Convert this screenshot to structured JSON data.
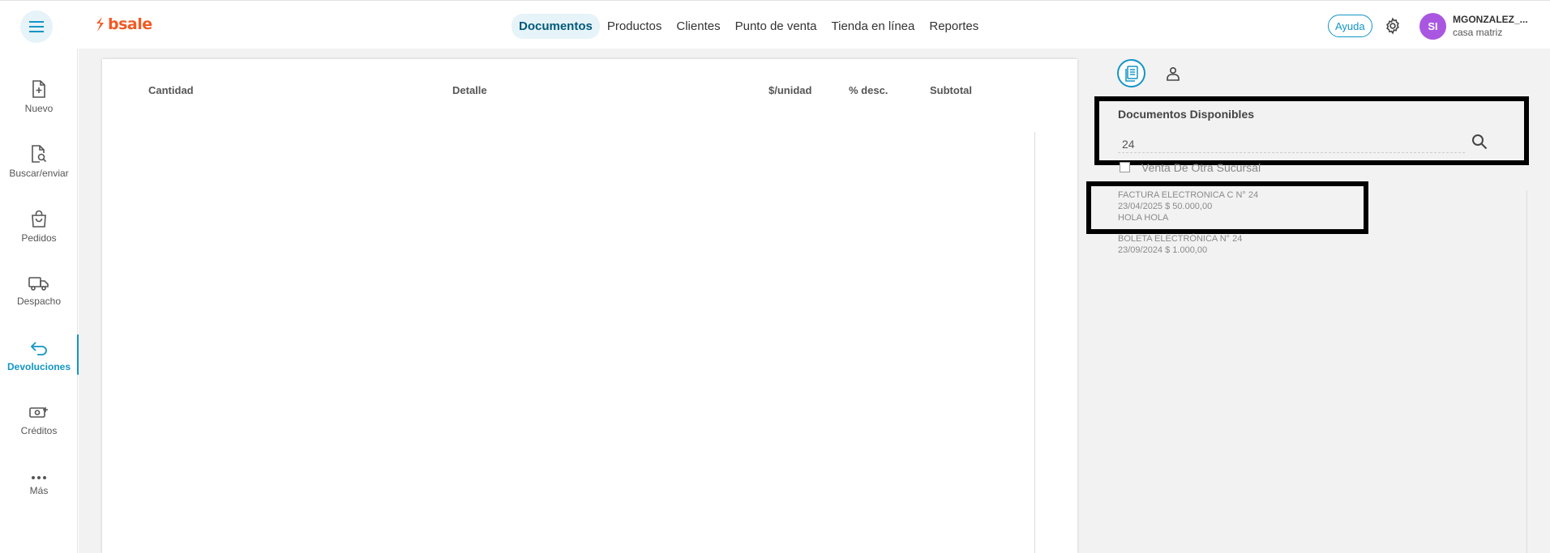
{
  "header": {
    "brand": "bsale",
    "nav": [
      {
        "label": "Documentos",
        "active": true
      },
      {
        "label": "Productos",
        "active": false
      },
      {
        "label": "Clientes",
        "active": false
      },
      {
        "label": "Punto de venta",
        "active": false
      },
      {
        "label": "Tienda en línea",
        "active": false
      },
      {
        "label": "Reportes",
        "active": false
      }
    ],
    "help_label": "Ayuda",
    "avatar_initials": "SI",
    "user_name": "MGONZALEZ_...",
    "user_branch": "casa matriz"
  },
  "sidebar": {
    "items": [
      {
        "label": "Nuevo",
        "icon": "file-plus-icon",
        "active": false
      },
      {
        "label": "Buscar/enviar",
        "icon": "file-search-icon",
        "active": false
      },
      {
        "label": "Pedidos",
        "icon": "shopping-bag-icon",
        "active": false
      },
      {
        "label": "Despacho",
        "icon": "truck-icon",
        "active": false
      },
      {
        "label": "Devoluciones",
        "icon": "return-arrow-icon",
        "active": true
      },
      {
        "label": "Créditos",
        "icon": "money-add-icon",
        "active": false
      },
      {
        "label": "Más",
        "icon": "more-dots-icon",
        "active": false
      }
    ]
  },
  "document": {
    "columns": [
      "Cantidad",
      "Detalle",
      "$/unidad",
      "% desc.",
      "Subtotal"
    ]
  },
  "panel": {
    "title": "Documentos Disponibles",
    "search_value": "24",
    "other_branch_label": "Venta De Otra Sucursal",
    "other_branch_checked": false,
    "results": [
      {
        "lines": [
          "FACTURA ELECTRONICA C N° 24",
          "23/04/2025 $ 50.000,00",
          "HOLA HOLA"
        ]
      },
      {
        "lines": [
          "BOLETA ELECTRÓNICA N° 24",
          "23/09/2024 $ 1.000,00"
        ]
      }
    ]
  },
  "colors": {
    "brand": "#f15a24",
    "accent": "#1395c6",
    "avatar": "#a957e0"
  }
}
